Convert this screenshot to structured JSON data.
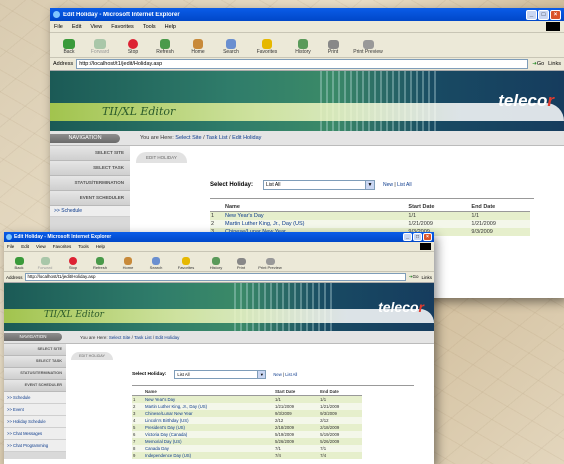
{
  "window_title": "Edit Holiday - Microsoft Internet Explorer",
  "menu": [
    "File",
    "Edit",
    "View",
    "Favorites",
    "Tools",
    "Help"
  ],
  "toolbar": [
    "Back",
    "Forward",
    "Stop",
    "Refresh",
    "Home",
    "Search",
    "Favorites",
    "History",
    "Print",
    "Print Preview"
  ],
  "address_label": "Address",
  "address_url": "http://localhost/t1/jedit/Holiday.asp",
  "go_label": "Go",
  "links_label": "Links",
  "app_name": "TII/XL Editor",
  "brand": {
    "pre": "teleco",
    "dot": "r"
  },
  "nav_label": "NAVIGATION",
  "breadcrumb": {
    "prefix": "You are Here:",
    "items": [
      "Select Site",
      "Task List",
      "Edit Holiday"
    ],
    "sep": "/"
  },
  "sidebar": [
    "SELECT SITE",
    "SELECT TASK",
    "STATUS/TERMINATION",
    "EVENT SCHEDULER"
  ],
  "sidebar_links": [
    ">> Schedule",
    ">> Event",
    ">> Holiday Schedule",
    ">> Chat Messages",
    ">> Chat Programming"
  ],
  "tab_label": "EDIT HOLIDAY",
  "select_label": "Select Holiday:",
  "select_value": "List All",
  "actions": {
    "new": "New",
    "sep": "|",
    "list": "List All"
  },
  "table": {
    "headers": [
      "",
      "Name",
      "Start Date",
      "End Date"
    ],
    "rows": [
      [
        "1",
        "New Year's Day",
        "1/1",
        "1/1"
      ],
      [
        "2",
        "Martin Luther King, Jr., Day (US)",
        "1/21/2009",
        "1/21/2009"
      ],
      [
        "3",
        "Chinese/Lunar New Year",
        "9/3/2009",
        "9/3/2009"
      ],
      [
        "4",
        "Lincoln's Birthday (US)",
        "2/12",
        "2/12"
      ],
      [
        "5",
        "President's Day (US)",
        "2/18/2009",
        "2/18/2009"
      ],
      [
        "6",
        "Victoria Day (Canada)",
        "5/19/2009",
        "5/19/2009"
      ],
      [
        "7",
        "Memorial Day (US)",
        "5/26/2009",
        "5/26/2009"
      ],
      [
        "8",
        "Canada Day",
        "7/1",
        "7/1"
      ],
      [
        "9",
        "Independence Day (US)",
        "7/4",
        "7/4"
      ]
    ]
  },
  "colors": {
    "titlebar": "#0a5ce8",
    "accent": "#b9d64c",
    "row_alt": "#e6efcc",
    "link": "#0b3a8c"
  }
}
